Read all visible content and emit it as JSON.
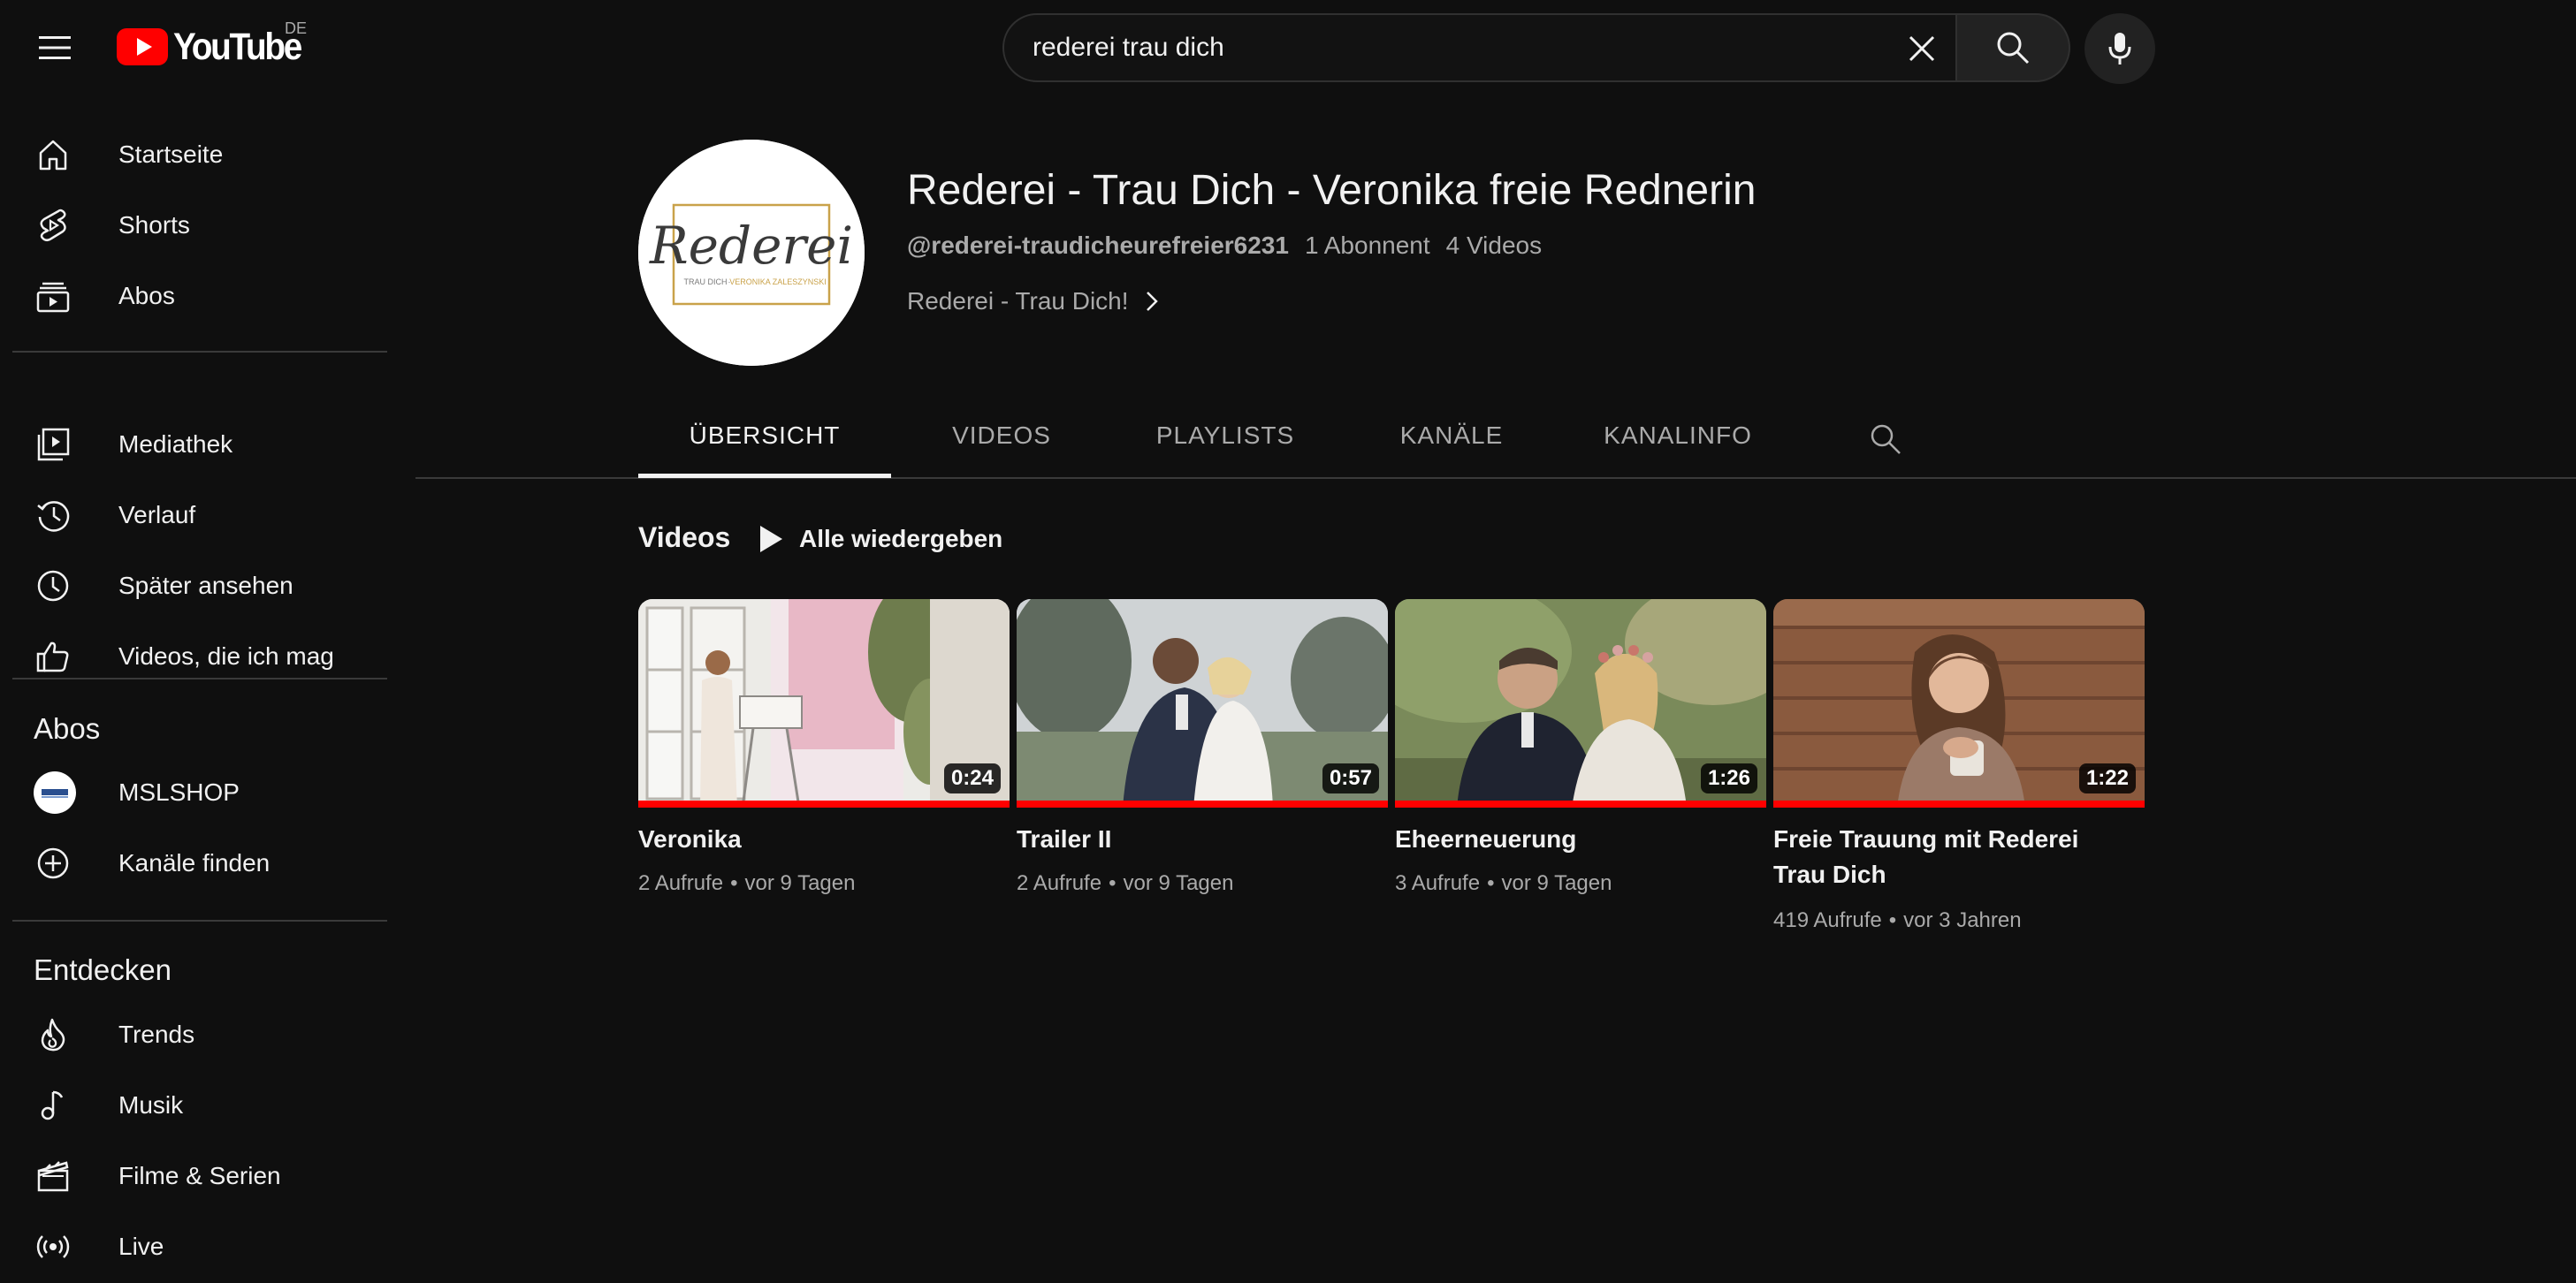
{
  "app": {
    "logo_text": "YouTube",
    "region": "DE"
  },
  "search": {
    "query": "rederei trau dich"
  },
  "sidebar": {
    "main": [
      {
        "label": "Startseite",
        "icon": "home-icon"
      },
      {
        "label": "Shorts",
        "icon": "shorts-icon"
      },
      {
        "label": "Abos",
        "icon": "subscriptions-icon"
      }
    ],
    "library": [
      {
        "label": "Mediathek",
        "icon": "library-icon"
      },
      {
        "label": "Verlauf",
        "icon": "history-icon"
      },
      {
        "label": "Später ansehen",
        "icon": "watch-later-icon"
      },
      {
        "label": "Videos, die ich mag",
        "icon": "like-icon"
      }
    ],
    "subs_heading": "Abos",
    "subs": [
      {
        "label": "MSLSHOP",
        "icon": "channel-avatar"
      },
      {
        "label": "Kanäle finden",
        "icon": "add-circle-icon"
      }
    ],
    "explore_heading": "Entdecken",
    "explore": [
      {
        "label": "Trends",
        "icon": "trending-icon"
      },
      {
        "label": "Musik",
        "icon": "music-icon"
      },
      {
        "label": "Filme & Serien",
        "icon": "movies-icon"
      },
      {
        "label": "Live",
        "icon": "live-icon"
      }
    ]
  },
  "channel": {
    "name": "Rederei - Trau Dich - Veronika freie Rednerin",
    "handle": "@rederei-traudicheurefreier6231",
    "subscribers": "1 Abonnent",
    "video_count": "4 Videos",
    "link_text": "Rederei - Trau Dich!",
    "avatar": {
      "script_text": "Rederei",
      "subtitle_left": "TRAU DICH",
      "subtitle_right": "VERONIKA ZALESZYNSKI"
    }
  },
  "tabs": [
    {
      "label": "ÜBERSICHT",
      "active": true
    },
    {
      "label": "VIDEOS",
      "active": false
    },
    {
      "label": "PLAYLISTS",
      "active": false
    },
    {
      "label": "KANÄLE",
      "active": false
    },
    {
      "label": "KANALINFO",
      "active": false
    }
  ],
  "shelf": {
    "title": "Videos",
    "play_all": "Alle wiedergeben",
    "videos": [
      {
        "title": "Veronika",
        "duration": "0:24",
        "views": "2 Aufrufe",
        "age": "vor 9 Tagen",
        "watched_fraction": 1.0
      },
      {
        "title": "Trailer II",
        "duration": "0:57",
        "views": "2 Aufrufe",
        "age": "vor 9 Tagen",
        "watched_fraction": 1.0
      },
      {
        "title": "Eheerneuerung",
        "duration": "1:26",
        "views": "3 Aufrufe",
        "age": "vor 9 Tagen",
        "watched_fraction": 1.0
      },
      {
        "title": "Freie Trauung mit Rederei Trau Dich",
        "duration": "1:22",
        "views": "419 Aufrufe",
        "age": "vor 3 Jahren",
        "watched_fraction": 1.0
      }
    ]
  },
  "colors": {
    "background": "#0f0f0f",
    "text_primary": "#f1f1f1",
    "text_secondary": "#aaaaaa",
    "accent_red": "#ff0000",
    "logo_gold": "#c9a24a"
  }
}
